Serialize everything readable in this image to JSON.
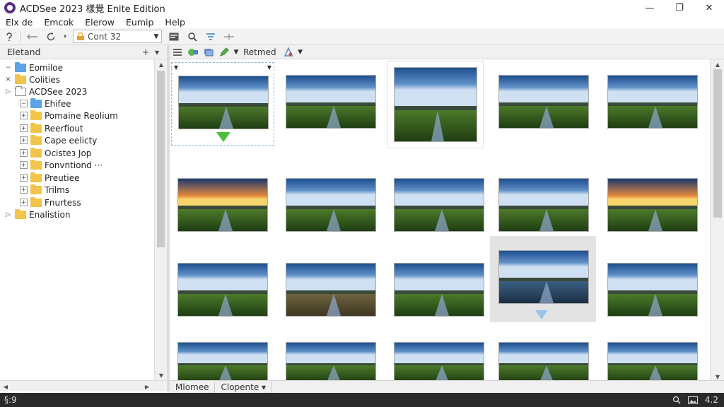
{
  "window": {
    "title": "ACDSee 2023 樣覺 Enite Edition",
    "controls": [
      "—",
      "❐",
      "✕"
    ]
  },
  "menu": [
    "Elx de",
    "Emcok",
    "Elerow",
    "Eumip",
    "Help"
  ],
  "toolbar": {
    "combo_value": "Cont 32"
  },
  "tree_panel": {
    "title": "Eletand",
    "add_glyph": "+",
    "menu_glyph": "▾",
    "items": [
      {
        "label": "Eomiloe",
        "indent": 0,
        "exp": "−",
        "folder": "blue"
      },
      {
        "label": "Colities",
        "indent": 0,
        "exp": "✕",
        "folder": "yellow"
      },
      {
        "label": "ACDSee 2023",
        "indent": 1,
        "exp": "▷",
        "folder": "open"
      },
      {
        "label": "Ehifee",
        "indent": 2,
        "exp": "−",
        "folder": "blue"
      },
      {
        "label": "Pomaine Reolium",
        "indent": 2,
        "exp": "+",
        "folder": "yellow"
      },
      {
        "label": "Reerfiout",
        "indent": 2,
        "exp": "+",
        "folder": "yellow"
      },
      {
        "label": "Cape eelicty",
        "indent": 2,
        "exp": "+",
        "folder": "yellow"
      },
      {
        "label": "Ocisteз Jop",
        "indent": 2,
        "exp": "+",
        "folder": "yellow"
      },
      {
        "label": "Fonvntiond ···",
        "indent": 2,
        "exp": "+",
        "folder": "yellow"
      },
      {
        "label": "Preutiee",
        "indent": 2,
        "exp": "+",
        "folder": "yellow"
      },
      {
        "label": "Trilms",
        "indent": 2,
        "exp": "+",
        "folder": "yellow"
      },
      {
        "label": "Fnurtess",
        "indent": 2,
        "exp": "+",
        "folder": "yellow"
      },
      {
        "label": "Enalistion",
        "indent": 1,
        "exp": "▷",
        "folder": "yellow"
      }
    ]
  },
  "view_toolbar": {
    "label": "Retmed"
  },
  "bottom_tabs": [
    "Mlomee",
    "Clopente ▾"
  ],
  "status": {
    "left": "§:9",
    "right_value": "4.2"
  },
  "colors": {
    "accent_green": "#4bbf3a",
    "selection_blue": "#9ec3ea",
    "status_bar": "#2a2a2a"
  }
}
